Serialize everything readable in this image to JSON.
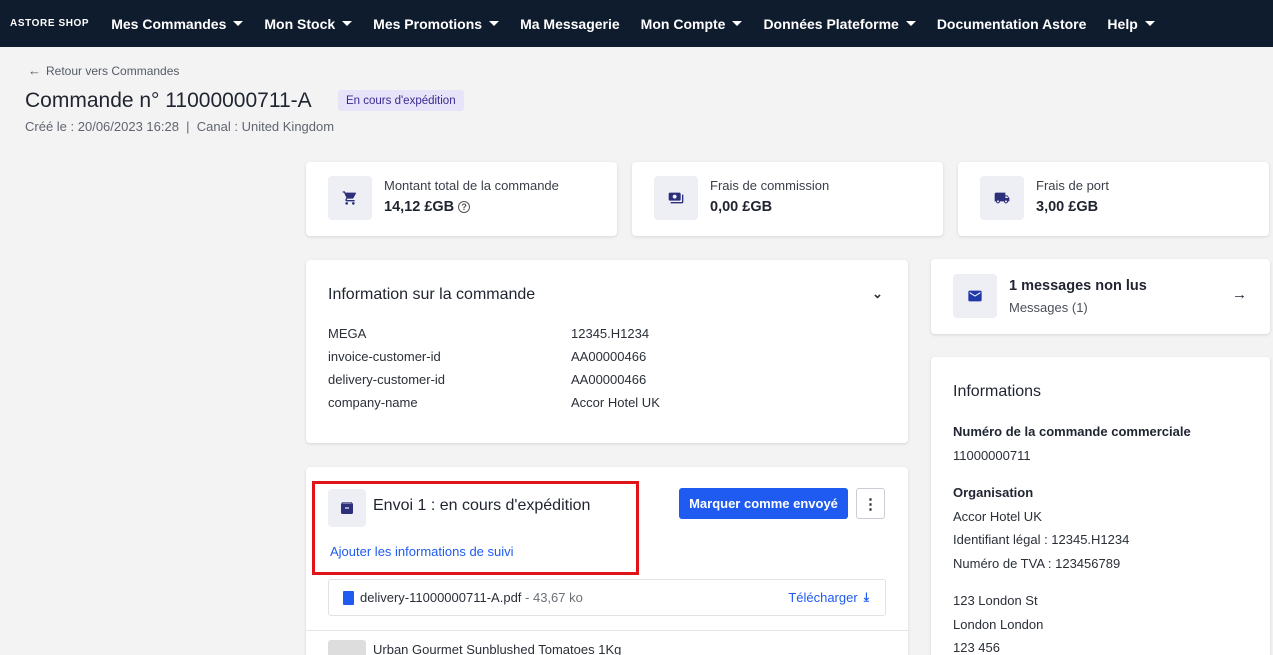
{
  "nav": {
    "brand": "ASTORE SHOP",
    "items": [
      {
        "label": "Mes Commandes",
        "dropdown": true
      },
      {
        "label": "Mon Stock",
        "dropdown": true
      },
      {
        "label": "Mes Promotions",
        "dropdown": true
      },
      {
        "label": "Ma Messagerie",
        "dropdown": false
      },
      {
        "label": "Mon Compte",
        "dropdown": true
      },
      {
        "label": "Données Plateforme",
        "dropdown": true
      },
      {
        "label": "Documentation Astore",
        "dropdown": false
      },
      {
        "label": "Help",
        "dropdown": true
      }
    ]
  },
  "header": {
    "back_label": "Retour vers Commandes",
    "title": "Commande n° 11000000711-A",
    "status_badge": "En cours d'expédition",
    "meta": "Créé le : 20/06/2023 16:28  |  Canal : United Kingdom"
  },
  "stats": {
    "total": {
      "label": "Montant total de la commande",
      "value": "14,12 £GB",
      "icon": "cart-icon"
    },
    "commission": {
      "label": "Frais de commission",
      "value": "0,00 £GB",
      "icon": "money-icon"
    },
    "shipping": {
      "label": "Frais de port",
      "value": "3,00 £GB",
      "icon": "truck-icon"
    }
  },
  "order_info": {
    "title": "Information sur la commande",
    "rows": [
      {
        "key": "MEGA",
        "value": "12345.H1234"
      },
      {
        "key": "invoice-customer-id",
        "value": "AA00000466"
      },
      {
        "key": "delivery-customer-id",
        "value": "AA00000466"
      },
      {
        "key": "company-name",
        "value": "Accor Hotel UK"
      }
    ]
  },
  "shipment": {
    "title": "Envoi 1 : en cours d'expédition",
    "mark_sent_label": "Marquer comme envoyé",
    "more_label": "⋮",
    "tracking_link": "Ajouter les informations de suivi",
    "file_name": "delivery-11000000711-A.pdf",
    "file_size": " - 43,67 ko",
    "download_label": "Télécharger",
    "product_name": "Urban Gourmet Sunblushed Tomatoes 1Kg"
  },
  "messages": {
    "title": "1 messages non lus",
    "subtitle": "Messages (1)"
  },
  "informations": {
    "title": "Informations",
    "commercial_order_label": "Numéro de la commande commerciale",
    "commercial_order_value": "11000000711",
    "organisation_label": "Organisation",
    "organisation_name": "Accor Hotel UK",
    "legal_id": "Identifiant légal : 12345.H1234",
    "vat": "Numéro de TVA : 123456789",
    "address_line1": "123 London St",
    "address_line2": "London London",
    "address_line3": "123 456"
  },
  "colors": {
    "nav_bg": "#0f1c2e",
    "primary": "#1f5bf0",
    "badge_bg": "#e7e3f8",
    "highlight": "#e01418"
  }
}
